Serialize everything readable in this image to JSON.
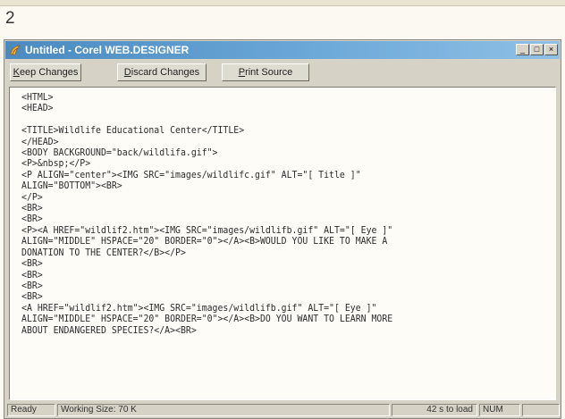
{
  "figure_number": "2",
  "window": {
    "title": "Untitled - Corel WEB.DESIGNER",
    "controls": {
      "minimize": "_",
      "maximize": "□",
      "close": "×"
    }
  },
  "toolbar": {
    "keep_changes": {
      "mnemonic": "K",
      "rest": "eep Changes"
    },
    "discard_changes": {
      "mnemonic": "D",
      "rest": "iscard Changes"
    },
    "print_source": {
      "mnemonic": "P",
      "rest": "rint Source"
    }
  },
  "source_code": "<HTML>\n<HEAD>\n\n<TITLE>Wildlife Educational Center</TITLE>\n</HEAD>\n<BODY BACKGROUND=\"back/wildlifa.gif\">\n<P>&nbsp;</P>\n<P ALIGN=\"center\"><IMG SRC=\"images/wildlifc.gif\" ALT=\"[ Title ]\"\nALIGN=\"BOTTOM\"><BR>\n</P>\n<BR>\n<BR>\n<P><A HREF=\"wildlif2.htm\"><IMG SRC=\"images/wildlifb.gif\" ALT=\"[ Eye ]\"\nALIGN=\"MIDDLE\" HSPACE=\"20\" BORDER=\"0\"></A><B>WOULD YOU LIKE TO MAKE A\nDONATION TO THE CENTER?</B></P>\n<BR>\n<BR>\n<BR>\n<BR>\n<A HREF=\"wildlif2.htm\"><IMG SRC=\"images/wildlifb.gif\" ALT=\"[ Eye ]\"\nALIGN=\"MIDDLE\" HSPACE=\"20\" BORDER=\"0\"></A><B>DO YOU WANT TO LEARN MORE\nABOUT ENDANGERED SPECIES?</A><BR>",
  "statusbar": {
    "ready": "Ready",
    "working_size": "Working Size: 70 K",
    "load_time": "42 s to load",
    "num": "NUM"
  },
  "colors": {
    "titlebar_start": "#4a8ac0",
    "titlebar_end": "#8fc0e6",
    "window_face": "#d6d2c6",
    "editor_bg": "#fdfcf7"
  }
}
